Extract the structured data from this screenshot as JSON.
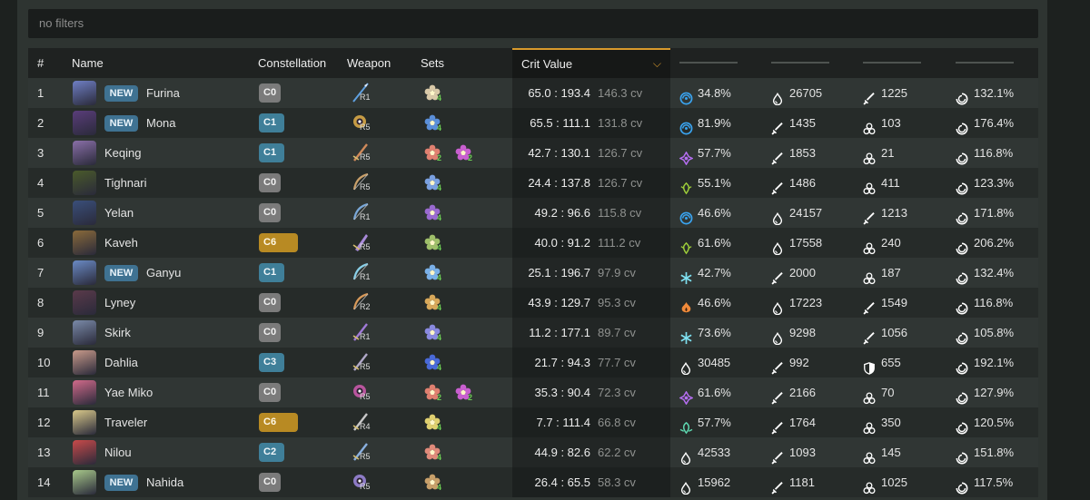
{
  "filter": {
    "placeholder": "no filters"
  },
  "headers": {
    "index": "#",
    "name": "Name",
    "constellation": "Constellation",
    "weapon": "Weapon",
    "sets": "Sets",
    "crit_value": "Crit Value",
    "sort_icon": "chevron-down-icon"
  },
  "colors": {
    "accent": "#d89a2c",
    "new_badge": "#3f7292",
    "cons_grey": "#7b7b7b",
    "cons_blue": "#3f7f99",
    "cons_gold": "#b88a23",
    "set_count": "#6ccd54"
  },
  "rows": [
    {
      "idx": "1",
      "new": "NEW",
      "name": "Furina",
      "avatar_color": "#6f7fc4",
      "cons": "C0",
      "cons_style": "grey",
      "weapon": "spear-icon",
      "weapon_color": "#5fa0e0",
      "refine": "R1",
      "sets": [
        {
          "icon": "flower-artifact-icon",
          "color": "#d9c9a8",
          "count": "4"
        }
      ],
      "crit": "65.0 : 193.4",
      "cv": "146.3 cv",
      "stats": [
        {
          "icon": "hydro-icon",
          "color": "#3aa4f0",
          "value": "34.8%"
        },
        {
          "icon": "hp-drop-icon",
          "color": "#ffffff",
          "value": "26705"
        },
        {
          "icon": "atk-sword-icon",
          "color": "#ffffff",
          "value": "1225"
        },
        {
          "icon": "energy-recharge-icon",
          "color": "#ffffff",
          "value": "132.1%"
        }
      ]
    },
    {
      "idx": "2",
      "new": "NEW",
      "name": "Mona",
      "avatar_color": "#5a3d7a",
      "cons": "C1",
      "cons_style": "blue",
      "weapon": "catalyst-icon",
      "weapon_color": "#e3b04a",
      "refine": "R5",
      "sets": [
        {
          "icon": "flower-artifact-icon",
          "color": "#5b8fd9",
          "count": "4"
        }
      ],
      "crit": "65.5 : 111.1",
      "cv": "131.8 cv",
      "stats": [
        {
          "icon": "hydro-icon",
          "color": "#3aa4f0",
          "value": "81.9%"
        },
        {
          "icon": "atk-sword-icon",
          "color": "#ffffff",
          "value": "1435"
        },
        {
          "icon": "elemental-mastery-icon",
          "color": "#ffffff",
          "value": "103"
        },
        {
          "icon": "energy-recharge-icon",
          "color": "#ffffff",
          "value": "176.4%"
        }
      ]
    },
    {
      "idx": "3",
      "new": "",
      "name": "Keqing",
      "avatar_color": "#8a6fa8",
      "cons": "C1",
      "cons_style": "blue",
      "weapon": "sword-icon",
      "weapon_color": "#d08a5a",
      "refine": "R5",
      "sets": [
        {
          "icon": "flower-artifact-icon",
          "color": "#e08070",
          "count": "2"
        },
        {
          "icon": "flower-artifact-icon",
          "color": "#c95fd0",
          "count": "2"
        }
      ],
      "crit": "42.7 : 130.1",
      "cv": "126.7 cv",
      "stats": [
        {
          "icon": "electro-icon",
          "color": "#b46ef0",
          "value": "57.7%"
        },
        {
          "icon": "atk-sword-icon",
          "color": "#ffffff",
          "value": "1853"
        },
        {
          "icon": "elemental-mastery-icon",
          "color": "#ffffff",
          "value": "21"
        },
        {
          "icon": "energy-recharge-icon",
          "color": "#ffffff",
          "value": "116.8%"
        }
      ]
    },
    {
      "idx": "4",
      "new": "",
      "name": "Tighnari",
      "avatar_color": "#4a5a2a",
      "cons": "C0",
      "cons_style": "grey",
      "weapon": "bow-icon",
      "weapon_color": "#c9a06a",
      "refine": "R5",
      "sets": [
        {
          "icon": "flower-artifact-icon",
          "color": "#7aa0e0",
          "count": "4"
        }
      ],
      "crit": "24.4 : 137.8",
      "cv": "126.7 cv",
      "stats": [
        {
          "icon": "dendro-icon",
          "color": "#9fcf3a",
          "value": "55.1%"
        },
        {
          "icon": "atk-sword-icon",
          "color": "#ffffff",
          "value": "1486"
        },
        {
          "icon": "elemental-mastery-icon",
          "color": "#ffffff",
          "value": "411"
        },
        {
          "icon": "energy-recharge-icon",
          "color": "#ffffff",
          "value": "123.3%"
        }
      ]
    },
    {
      "idx": "5",
      "new": "",
      "name": "Yelan",
      "avatar_color": "#3a4f7a",
      "cons": "C0",
      "cons_style": "grey",
      "weapon": "bow-icon",
      "weapon_color": "#7aa8d8",
      "refine": "R1",
      "sets": [
        {
          "icon": "flower-artifact-icon",
          "color": "#9a6ad0",
          "count": "4"
        }
      ],
      "crit": "49.2 : 96.6",
      "cv": "115.8 cv",
      "stats": [
        {
          "icon": "hydro-icon",
          "color": "#3aa4f0",
          "value": "46.6%"
        },
        {
          "icon": "hp-drop-icon",
          "color": "#ffffff",
          "value": "24157"
        },
        {
          "icon": "atk-sword-icon",
          "color": "#ffffff",
          "value": "1213"
        },
        {
          "icon": "energy-recharge-icon",
          "color": "#ffffff",
          "value": "171.8%"
        }
      ]
    },
    {
      "idx": "6",
      "new": "",
      "name": "Kaveh",
      "avatar_color": "#8a6a3a",
      "cons": "C6",
      "cons_style": "gold",
      "weapon": "claymore-icon",
      "weapon_color": "#a88ad8",
      "refine": "R5",
      "sets": [
        {
          "icon": "flower-artifact-icon",
          "color": "#9fbf6a",
          "count": "4"
        }
      ],
      "crit": "40.0 : 91.2",
      "cv": "111.2 cv",
      "stats": [
        {
          "icon": "dendro-icon",
          "color": "#9fcf3a",
          "value": "61.6%"
        },
        {
          "icon": "hp-drop-icon",
          "color": "#ffffff",
          "value": "17558"
        },
        {
          "icon": "elemental-mastery-icon",
          "color": "#ffffff",
          "value": "240"
        },
        {
          "icon": "energy-recharge-icon",
          "color": "#ffffff",
          "value": "206.2%"
        }
      ]
    },
    {
      "idx": "7",
      "new": "NEW",
      "name": "Ganyu",
      "avatar_color": "#6a8ac4",
      "cons": "C1",
      "cons_style": "blue",
      "weapon": "bow-icon",
      "weapon_color": "#8ad0e8",
      "refine": "R1",
      "sets": [
        {
          "icon": "flower-artifact-icon",
          "color": "#7ab0e8",
          "count": "4"
        }
      ],
      "crit": "25.1 : 196.7",
      "cv": "97.9 cv",
      "stats": [
        {
          "icon": "cryo-icon",
          "color": "#7ee0f0",
          "value": "42.7%"
        },
        {
          "icon": "atk-sword-icon",
          "color": "#ffffff",
          "value": "2000"
        },
        {
          "icon": "elemental-mastery-icon",
          "color": "#ffffff",
          "value": "187"
        },
        {
          "icon": "energy-recharge-icon",
          "color": "#ffffff",
          "value": "132.4%"
        }
      ]
    },
    {
      "idx": "8",
      "new": "",
      "name": "Lyney",
      "avatar_color": "#5a3a4a",
      "cons": "C0",
      "cons_style": "grey",
      "weapon": "bow-icon",
      "weapon_color": "#d89a5a",
      "refine": "R2",
      "sets": [
        {
          "icon": "flower-artifact-icon",
          "color": "#d8a85a",
          "count": "4"
        }
      ],
      "crit": "43.9 : 129.7",
      "cv": "95.3 cv",
      "stats": [
        {
          "icon": "pyro-icon",
          "color": "#f08a3a",
          "value": "46.6%"
        },
        {
          "icon": "hp-drop-icon",
          "color": "#ffffff",
          "value": "17223"
        },
        {
          "icon": "atk-sword-icon",
          "color": "#ffffff",
          "value": "1549"
        },
        {
          "icon": "energy-recharge-icon",
          "color": "#ffffff",
          "value": "116.8%"
        }
      ]
    },
    {
      "idx": "9",
      "new": "",
      "name": "Skirk",
      "avatar_color": "#7a8aa8",
      "cons": "C0",
      "cons_style": "grey",
      "weapon": "sword-icon",
      "weapon_color": "#a07ad8",
      "refine": "R1",
      "sets": [
        {
          "icon": "flower-artifact-icon",
          "color": "#8a8ae0",
          "count": "4"
        }
      ],
      "crit": "11.2 : 177.1",
      "cv": "89.7 cv",
      "stats": [
        {
          "icon": "cryo-icon",
          "color": "#7ee0f0",
          "value": "73.6%"
        },
        {
          "icon": "hp-drop-icon",
          "color": "#ffffff",
          "value": "9298"
        },
        {
          "icon": "atk-sword-icon",
          "color": "#ffffff",
          "value": "1056"
        },
        {
          "icon": "energy-recharge-icon",
          "color": "#ffffff",
          "value": "105.8%"
        }
      ]
    },
    {
      "idx": "10",
      "new": "",
      "name": "Dahlia",
      "avatar_color": "#c89a8a",
      "cons": "C3",
      "cons_style": "blue",
      "weapon": "sword-icon",
      "weapon_color": "#b0a8c8",
      "refine": "R5",
      "sets": [
        {
          "icon": "flower-artifact-icon",
          "color": "#4a6ad8",
          "count": "4"
        }
      ],
      "crit": "21.7 : 94.3",
      "cv": "77.7 cv",
      "stats": [
        {
          "icon": "hp-drop-icon",
          "color": "#ffffff",
          "value": "30485"
        },
        {
          "icon": "atk-sword-icon",
          "color": "#ffffff",
          "value": "992"
        },
        {
          "icon": "def-shield-icon",
          "color": "#ffffff",
          "value": "655"
        },
        {
          "icon": "energy-recharge-icon",
          "color": "#ffffff",
          "value": "192.1%"
        }
      ]
    },
    {
      "idx": "11",
      "new": "",
      "name": "Yae Miko",
      "avatar_color": "#d06a8a",
      "cons": "C0",
      "cons_style": "grey",
      "weapon": "catalyst-icon",
      "weapon_color": "#d05ab0",
      "refine": "R5",
      "sets": [
        {
          "icon": "flower-artifact-icon",
          "color": "#e08070",
          "count": "2"
        },
        {
          "icon": "flower-artifact-icon",
          "color": "#c95fd0",
          "count": "2"
        }
      ],
      "crit": "35.3 : 90.4",
      "cv": "72.3 cv",
      "stats": [
        {
          "icon": "electro-icon",
          "color": "#b46ef0",
          "value": "61.6%"
        },
        {
          "icon": "atk-sword-icon",
          "color": "#ffffff",
          "value": "2166"
        },
        {
          "icon": "elemental-mastery-icon",
          "color": "#ffffff",
          "value": "70"
        },
        {
          "icon": "energy-recharge-icon",
          "color": "#ffffff",
          "value": "127.9%"
        }
      ]
    },
    {
      "idx": "12",
      "new": "",
      "name": "Traveler",
      "avatar_color": "#d8c88a",
      "cons": "C6",
      "cons_style": "gold",
      "weapon": "sword-icon",
      "weapon_color": "#c8c8c8",
      "refine": "R4",
      "sets": [
        {
          "icon": "flower-artifact-icon",
          "color": "#e0d070",
          "count": "4"
        }
      ],
      "crit": "7.7 : 111.4",
      "cv": "66.8 cv",
      "stats": [
        {
          "icon": "anemo-icon",
          "color": "#5ed8b0",
          "value": "57.7%"
        },
        {
          "icon": "atk-sword-icon",
          "color": "#ffffff",
          "value": "1764"
        },
        {
          "icon": "elemental-mastery-icon",
          "color": "#ffffff",
          "value": "350"
        },
        {
          "icon": "energy-recharge-icon",
          "color": "#ffffff",
          "value": "120.5%"
        }
      ]
    },
    {
      "idx": "13",
      "new": "",
      "name": "Nilou",
      "avatar_color": "#c84a4a",
      "cons": "C2",
      "cons_style": "blue",
      "weapon": "sword-icon",
      "weapon_color": "#8ab0e0",
      "refine": "R5",
      "sets": [
        {
          "icon": "flower-artifact-icon",
          "color": "#e08a7a",
          "count": "4"
        }
      ],
      "crit": "44.9 : 82.6",
      "cv": "62.2 cv",
      "stats": [
        {
          "icon": "hp-drop-icon",
          "color": "#ffffff",
          "value": "42533"
        },
        {
          "icon": "atk-sword-icon",
          "color": "#ffffff",
          "value": "1093"
        },
        {
          "icon": "elemental-mastery-icon",
          "color": "#ffffff",
          "value": "145"
        },
        {
          "icon": "energy-recharge-icon",
          "color": "#ffffff",
          "value": "151.8%"
        }
      ]
    },
    {
      "idx": "14",
      "new": "NEW",
      "name": "Nahida",
      "avatar_color": "#a8c88a",
      "cons": "C0",
      "cons_style": "grey",
      "weapon": "catalyst-icon",
      "weapon_color": "#a08ae0",
      "refine": "R5",
      "sets": [
        {
          "icon": "flower-artifact-icon",
          "color": "#c8a06a",
          "count": "4"
        }
      ],
      "crit": "26.4 : 65.5",
      "cv": "58.3 cv",
      "stats": [
        {
          "icon": "hp-drop-icon",
          "color": "#ffffff",
          "value": "15962"
        },
        {
          "icon": "atk-sword-icon",
          "color": "#ffffff",
          "value": "1181"
        },
        {
          "icon": "elemental-mastery-icon",
          "color": "#ffffff",
          "value": "1025"
        },
        {
          "icon": "energy-recharge-icon",
          "color": "#ffffff",
          "value": "117.5%"
        }
      ]
    }
  ]
}
